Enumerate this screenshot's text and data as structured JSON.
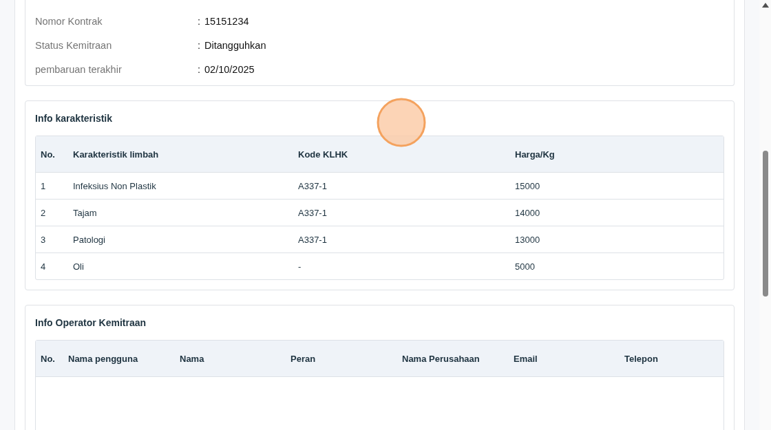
{
  "contract_info": [
    {
      "label": "Nomor Kontrak",
      "value": "15151234"
    },
    {
      "label": "Status Kemitraan",
      "value": "Ditangguhkan"
    },
    {
      "label": "pembaruan terakhir",
      "value": "02/10/2025"
    }
  ],
  "separator": ":",
  "characteristics": {
    "title": "Info karakteristik",
    "columns": [
      "No.",
      "Karakteristik limbah",
      "Kode KLHK",
      "Harga/Kg"
    ],
    "rows": [
      [
        "1",
        "Infeksius Non Plastik",
        "A337-1",
        "15000"
      ],
      [
        "2",
        "Tajam",
        "A337-1",
        "14000"
      ],
      [
        "3",
        "Patologi",
        "A337-1",
        "13000"
      ],
      [
        "4",
        "Oli",
        "-",
        "5000"
      ]
    ]
  },
  "operators": {
    "title": "Info Operator Kemitraan",
    "columns": [
      "No.",
      "Nama pengguna",
      "Nama",
      "Peran",
      "Nama Perusahaan",
      "Email",
      "Telepon"
    ]
  }
}
